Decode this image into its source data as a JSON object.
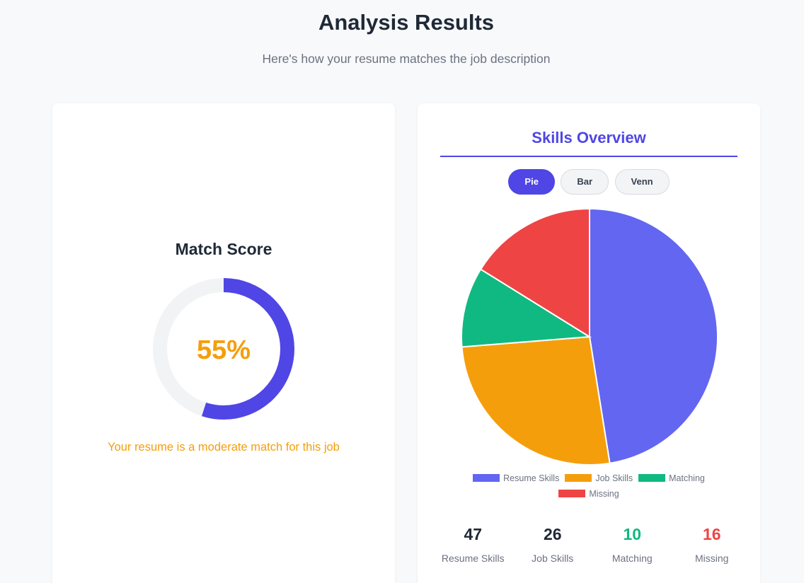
{
  "header": {
    "title": "Analysis Results",
    "subtitle": "Here's how your resume matches the job description"
  },
  "match_score": {
    "title": "Match Score",
    "value_label": "55%",
    "value": 55,
    "message": "Your resume is a moderate match for this job",
    "colors": {
      "ring": "#4f46e5",
      "track": "#f2f3f5",
      "text": "#f59e0b"
    }
  },
  "skills": {
    "title": "Skills Overview",
    "tabs": [
      {
        "label": "Pie",
        "active": true
      },
      {
        "label": "Bar",
        "active": false
      },
      {
        "label": "Venn",
        "active": false
      }
    ],
    "stats": [
      {
        "value": "47",
        "label": "Resume Skills",
        "color": "#1f2937"
      },
      {
        "value": "26",
        "label": "Job Skills",
        "color": "#1f2937"
      },
      {
        "value": "10",
        "label": "Matching",
        "color": "#10b981"
      },
      {
        "value": "16",
        "label": "Missing",
        "color": "#ef4444"
      }
    ]
  },
  "chart_data": {
    "type": "pie",
    "categories": [
      "Resume Skills",
      "Job Skills",
      "Matching",
      "Missing"
    ],
    "values": [
      47,
      26,
      10,
      16
    ],
    "colors": [
      "#6366f1",
      "#f59e0b",
      "#10b981",
      "#ef4444"
    ],
    "legend": "bottom"
  }
}
